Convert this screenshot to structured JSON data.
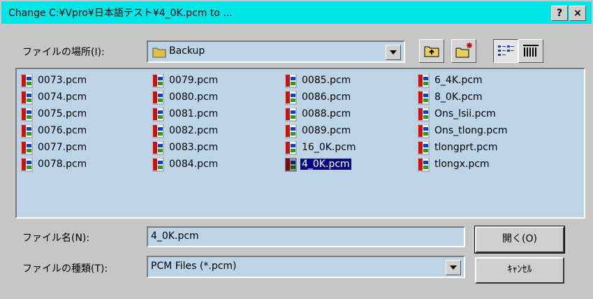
{
  "window": {
    "title": "Change C:¥Vpro¥日本語テスト¥4_0K.pcm to ...",
    "help_label": "?",
    "close_label": "×"
  },
  "location": {
    "label": "ファイルの場所(I):",
    "value": "Backup",
    "folder_icon": "folder-icon"
  },
  "toolbar": {
    "up_icon": "up-folder-icon",
    "new_folder_icon": "new-folder-icon",
    "list_view_icon": "list-view-icon",
    "details_view_icon": "details-view-icon"
  },
  "files": {
    "col1": [
      "0073.pcm",
      "0074.pcm",
      "0075.pcm",
      "0076.pcm",
      "0077.pcm",
      "0078.pcm"
    ],
    "col2": [
      "0079.pcm",
      "0080.pcm",
      "0081.pcm",
      "0082.pcm",
      "0083.pcm",
      "0084.pcm"
    ],
    "col3": [
      "0085.pcm",
      "0086.pcm",
      "0088.pcm",
      "0089.pcm",
      "16_0K.pcm",
      "4_0K.pcm"
    ],
    "col4": [
      "6_4K.pcm",
      "8_0K.pcm",
      "Ons_lsii.pcm",
      "Ons_tlong.pcm",
      "tlongprt.pcm",
      "tlongx.pcm"
    ],
    "selected": "4_0K.pcm",
    "icon": "pcm-file-icon"
  },
  "filename": {
    "label": "ファイル名(N):",
    "value": "4_0K.pcm"
  },
  "filetype": {
    "label": "ファイルの種類(T):",
    "value": "PCM Files (*.pcm)"
  },
  "buttons": {
    "open": "開く(O)",
    "cancel": "ｷｬﾝｾﾙ"
  },
  "colors": {
    "titlebar": "#00e6e6",
    "field_bg": "#bcd4e6",
    "selection": "#0a0a80"
  }
}
